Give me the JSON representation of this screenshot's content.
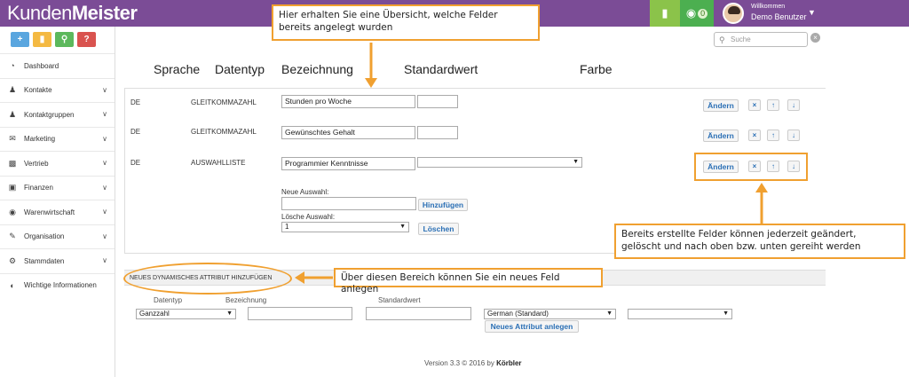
{
  "app": {
    "logo_light": "Kunden",
    "logo_bold": "Meister"
  },
  "topbar": {
    "msg_count": "0",
    "welcome": "Willkommen",
    "user_name": "Demo Benutzer"
  },
  "search": {
    "placeholder": "Suche"
  },
  "sidebar": {
    "items": [
      {
        "label": "Dashboard",
        "icon": "dashboard-icon",
        "chevron": false
      },
      {
        "label": "Kontakte",
        "icon": "user-icon",
        "chevron": true
      },
      {
        "label": "Kontaktgruppen",
        "icon": "users-icon",
        "chevron": true
      },
      {
        "label": "Marketing",
        "icon": "envelope-icon",
        "chevron": true
      },
      {
        "label": "Vertrieb",
        "icon": "bar-chart-icon",
        "chevron": true
      },
      {
        "label": "Finanzen",
        "icon": "money-icon",
        "chevron": true
      },
      {
        "label": "Warenwirtschaft",
        "icon": "globe-icon",
        "chevron": true
      },
      {
        "label": "Organisation",
        "icon": "edit-icon",
        "chevron": true
      },
      {
        "label": "Stammdaten",
        "icon": "cogs-icon",
        "chevron": true
      },
      {
        "label": "Wichtige Informationen",
        "icon": "info-circle-icon",
        "chevron": false
      }
    ]
  },
  "columns": {
    "sprache": "Sprache",
    "datentyp": "Datentyp",
    "bezeichnung": "Bezeichnung",
    "standardwert": "Standardwert",
    "farbe": "Farbe"
  },
  "rows": [
    {
      "lang": "DE",
      "type": "GLEITKOMMAZAHL",
      "name": "Stunden pro Woche",
      "default": ""
    },
    {
      "lang": "DE",
      "type": "GLEITKOMMAZAHL",
      "name": "Gewünschtes Gehalt",
      "default": ""
    },
    {
      "lang": "DE",
      "type": "AUSWAHLLISTE",
      "name": "Programmier Kenntnisse",
      "default": ""
    }
  ],
  "buttons": {
    "andern": "Ändern",
    "delete": "×",
    "up": "↑",
    "down": "↓",
    "hinzufuegen": "Hinzufügen",
    "loeschen": "Löschen",
    "neues_attribut": "Neues Attribut anlegen"
  },
  "selection": {
    "new_label": "Neue Auswahl:",
    "new_value": "",
    "delete_label": "Lösche Auswahl:",
    "delete_value": "1"
  },
  "new_attr": {
    "section_title": "NEUES DYNAMISCHES ATTRIBUT HINZUFÜGEN",
    "col_datentyp": "Datentyp",
    "col_bezeichnung": "Bezeichnung",
    "col_standardwert": "Standardwert",
    "datentyp_value": "Ganzzahl",
    "bezeichnung_value": "",
    "standardwert_value": "",
    "language_value": "German (Standard)",
    "color_value": ""
  },
  "footer": {
    "version": "Version 3.3 © 2016 by",
    "brand": "Körbler"
  },
  "callouts": {
    "top": "Hier erhalten Sie eine Übersicht, welche Felder bereits angelegt wurden",
    "right": "Bereits erstellte Felder können jederzeit geändert, gelöscht und nach oben bzw. unten gereiht werden",
    "middle": "Über diesen Bereich können Sie ein neues Feld anlegen"
  },
  "colors": {
    "brand": "#7b4c96",
    "highlight": "#f0a030",
    "link": "#2a6fb5"
  }
}
